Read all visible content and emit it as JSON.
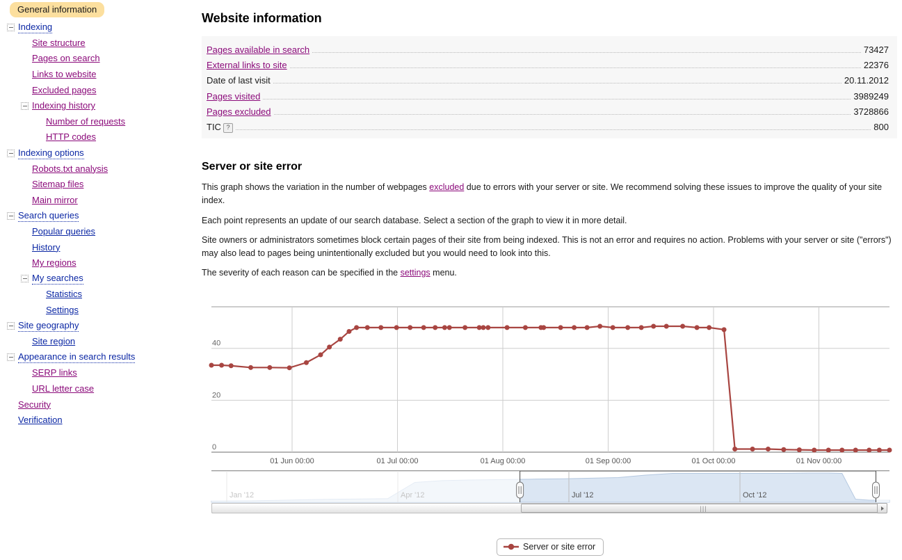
{
  "sidebar": {
    "current_label": "General information",
    "items": [
      {
        "label": "Indexing",
        "indent": 0,
        "toggle": true,
        "visited": false,
        "dotted": true
      },
      {
        "label": "Site structure",
        "indent": 1,
        "toggle": false,
        "visited": true,
        "dotted": false
      },
      {
        "label": "Pages on search",
        "indent": 1,
        "toggle": false,
        "visited": true,
        "dotted": false
      },
      {
        "label": "Links to website",
        "indent": 1,
        "toggle": false,
        "visited": true,
        "dotted": false
      },
      {
        "label": "Excluded pages",
        "indent": 1,
        "toggle": false,
        "visited": true,
        "dotted": false
      },
      {
        "label": "Indexing history",
        "indent": 1,
        "toggle": true,
        "visited": true,
        "dotted": false
      },
      {
        "label": "Number of requests",
        "indent": 2,
        "toggle": false,
        "visited": true,
        "dotted": false
      },
      {
        "label": "HTTP codes",
        "indent": 2,
        "toggle": false,
        "visited": true,
        "dotted": false
      },
      {
        "label": "Indexing options",
        "indent": 0,
        "toggle": true,
        "visited": false,
        "dotted": true
      },
      {
        "label": "Robots.txt analysis",
        "indent": 1,
        "toggle": false,
        "visited": true,
        "dotted": false
      },
      {
        "label": "Sitemap files",
        "indent": 1,
        "toggle": false,
        "visited": true,
        "dotted": false
      },
      {
        "label": "Main mirror",
        "indent": 1,
        "toggle": false,
        "visited": true,
        "dotted": false
      },
      {
        "label": "Search queries",
        "indent": 0,
        "toggle": true,
        "visited": false,
        "dotted": true
      },
      {
        "label": "Popular queries",
        "indent": 1,
        "toggle": false,
        "visited": false,
        "dotted": false
      },
      {
        "label": "History",
        "indent": 1,
        "toggle": false,
        "visited": false,
        "dotted": false
      },
      {
        "label": "My regions",
        "indent": 1,
        "toggle": false,
        "visited": true,
        "dotted": false
      },
      {
        "label": "My searches",
        "indent": 1,
        "toggle": true,
        "visited": false,
        "dotted": true
      },
      {
        "label": "Statistics",
        "indent": 2,
        "toggle": false,
        "visited": false,
        "dotted": false
      },
      {
        "label": "Settings",
        "indent": 2,
        "toggle": false,
        "visited": false,
        "dotted": false
      },
      {
        "label": "Site geography",
        "indent": 0,
        "toggle": true,
        "visited": false,
        "dotted": true
      },
      {
        "label": "Site region",
        "indent": 1,
        "toggle": false,
        "visited": false,
        "dotted": false
      },
      {
        "label": "Appearance in search results",
        "indent": 0,
        "toggle": true,
        "visited": false,
        "dotted": true
      },
      {
        "label": "SERP links",
        "indent": 1,
        "toggle": false,
        "visited": true,
        "dotted": false
      },
      {
        "label": "URL letter case",
        "indent": 1,
        "toggle": false,
        "visited": true,
        "dotted": false
      },
      {
        "label": "Security",
        "indent": 0,
        "toggle": false,
        "visited": true,
        "dotted": false
      },
      {
        "label": "Verification",
        "indent": 0,
        "toggle": false,
        "visited": false,
        "dotted": false
      }
    ]
  },
  "main": {
    "page_title": "Website information",
    "info_rows": [
      {
        "label": "Pages available in search",
        "value": "73427",
        "link": true,
        "help": false
      },
      {
        "label": "External links to site",
        "value": "22376",
        "link": true,
        "help": false
      },
      {
        "label": "Date of last visit",
        "value": "20.11.2012",
        "link": false,
        "help": false
      },
      {
        "label": "Pages visited",
        "value": "3989249",
        "link": true,
        "help": false
      },
      {
        "label": "Pages excluded",
        "value": "3728866",
        "link": true,
        "help": false
      },
      {
        "label": "TIC",
        "value": "800",
        "link": false,
        "help": true
      }
    ],
    "help_badge_glyph": "?",
    "section_title": "Server or site error",
    "paragraphs": {
      "p1_a": "This graph shows the variation in the number of webpages ",
      "p1_link": "excluded",
      "p1_b": " due to errors with your server or site. We recommend solving these issues to improve the quality of your site index.",
      "p2": "Each point represents an update of our search database. Select a section of the graph to view it in more detail.",
      "p3": "Site owners or administrators sometimes block certain pages of their site from being indexed. This is not an error and requires no action. Problems with your server or site (\"errors\") may also lead to pages being unintentionally excluded but you would need to look into this.",
      "p4_a": "The severity of each reason can be specified in the ",
      "p4_link": "settings",
      "p4_b": " menu."
    }
  },
  "chart_data": {
    "type": "line",
    "title": "",
    "xlabel": "",
    "ylabel": "",
    "series_name": "Server or site error",
    "color": "#a84541",
    "ylim": [
      0,
      56
    ],
    "yticks": [
      0,
      20,
      40
    ],
    "ytick_labels": [
      "0",
      "20",
      "40"
    ],
    "grid": true,
    "legend_position": "bottom",
    "xtick_labels": [
      "01 Jun 00:00",
      "01 Jul 00:00",
      "01 Aug 00:00",
      "01 Sep 00:00",
      "01 Oct 00:00",
      "01 Nov 00:00"
    ],
    "x": [
      0.0,
      1.5,
      2.9,
      5.8,
      8.6,
      11.5,
      14.0,
      16.1,
      17.4,
      19.0,
      20.3,
      21.4,
      23.0,
      25.0,
      27.3,
      29.3,
      31.3,
      33.0,
      34.4,
      35.1,
      37.4,
      39.5,
      40.1,
      40.8,
      43.6,
      46.3,
      48.6,
      49.0,
      51.5,
      53.5,
      55.4,
      57.3,
      59.2,
      61.4,
      63.4,
      65.2,
      67.1,
      69.5,
      71.6,
      73.4,
      75.6,
      77.2,
      79.8,
      82.1,
      84.4,
      86.7,
      88.9,
      91.0,
      93.0,
      95.0,
      97.0,
      98.5,
      100.0
    ],
    "y": [
      33.5,
      33.5,
      33.3,
      32.6,
      32.6,
      32.5,
      34.5,
      37.5,
      40.5,
      43.5,
      46.5,
      48.0,
      48.0,
      48.0,
      48.0,
      48.0,
      48.0,
      48.0,
      48.0,
      48.0,
      48.0,
      48.0,
      48.0,
      48.0,
      48.0,
      48.0,
      48.0,
      48.0,
      48.0,
      48.0,
      48.0,
      48.5,
      48.0,
      48.0,
      48.0,
      48.5,
      48.5,
      48.5,
      48.0,
      48.0,
      47.2,
      1.2,
      1.2,
      1.2,
      1.0,
      0.9,
      0.8,
      0.8,
      0.8,
      0.8,
      0.8,
      0.8,
      0.8
    ],
    "navigator": {
      "tick_labels": [
        "Jan '12",
        "Apr '12",
        "Jul '12",
        "Oct '12"
      ],
      "selection_start_pct": 45.5,
      "selection_end_pct": 98.0,
      "x": [
        0,
        6,
        9,
        11,
        13,
        15,
        18,
        22,
        26,
        30,
        34,
        38,
        42,
        45,
        48,
        52,
        56,
        60,
        64,
        68,
        72,
        76,
        80,
        84,
        88,
        91,
        93,
        95,
        97,
        100
      ],
      "y": [
        2,
        2.5,
        3,
        3.5,
        4,
        4.5,
        5,
        5.5,
        6,
        33,
        36,
        37,
        37.5,
        38,
        38.5,
        39,
        40,
        41,
        45,
        48,
        48,
        48,
        48,
        48,
        48.5,
        48.5,
        48,
        5,
        3.5,
        3.5
      ]
    }
  },
  "legend": {
    "label": "Server or site error"
  },
  "scrollbar": {
    "grip_glyph": "|||",
    "left_arrow": "◄",
    "right_arrow": "►"
  }
}
